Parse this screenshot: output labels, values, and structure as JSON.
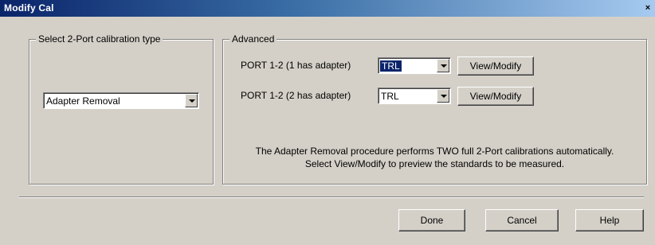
{
  "window": {
    "title": "Modify Cal",
    "close_glyph": "×"
  },
  "calibration_type": {
    "group_label": "Select 2-Port calibration type",
    "selected": "Adapter Removal"
  },
  "advanced": {
    "group_label": "Advanced",
    "rows": [
      {
        "label": "PORT 1-2 (1 has adapter)",
        "value": "TRL",
        "button": "View/Modify"
      },
      {
        "label": "PORT 1-2 (2 has adapter)",
        "value": "TRL",
        "button": "View/Modify"
      }
    ],
    "info_line1": "The Adapter Removal procedure performs TWO full 2-Port calibrations automatically.",
    "info_line2": "Select View/Modify to preview the standards to be measured."
  },
  "footer": {
    "done_label": "Done",
    "cancel_label": "Cancel",
    "help_label": "Help"
  },
  "colors": {
    "titlebar_start": "#0a246a",
    "titlebar_end": "#a6caf0",
    "dialog_bg": "#d4d0c8",
    "selection": "#0a246a"
  }
}
